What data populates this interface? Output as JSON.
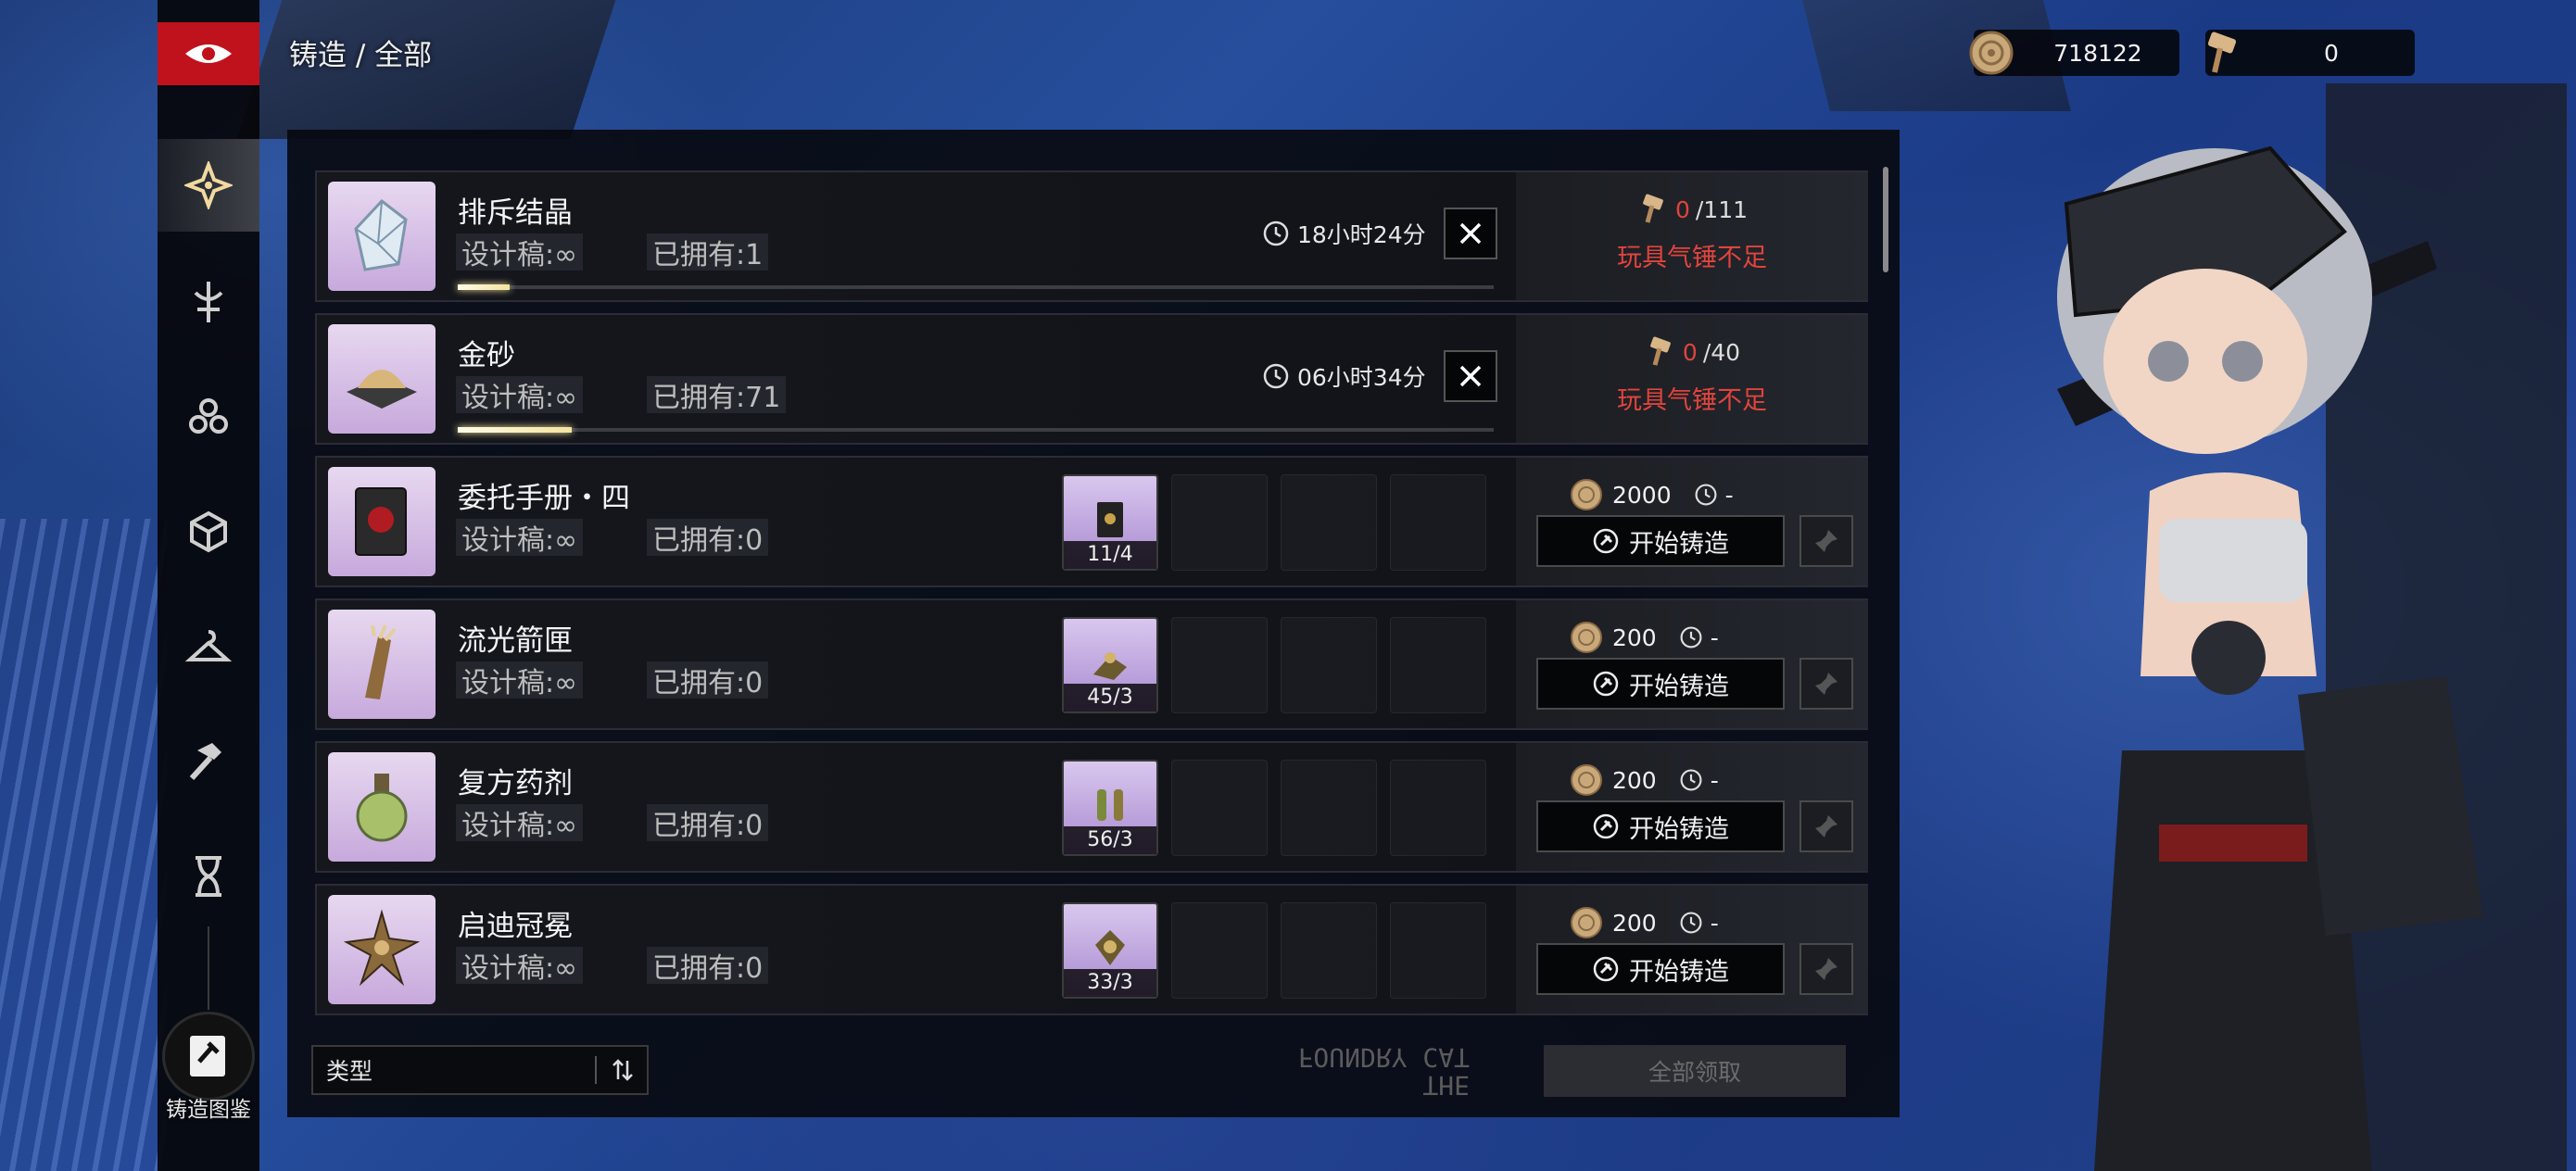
{
  "breadcrumb": "铸造 / 全部",
  "currency": {
    "coins": "718122",
    "hammers": "0"
  },
  "sidebar": {
    "items": [
      "all",
      "weapon",
      "relic",
      "box",
      "hanger",
      "hammer",
      "hourglass"
    ],
    "active_index": 0,
    "codex_label": "铸造图鉴"
  },
  "forging": [
    {
      "name": "排斥结晶",
      "design": "设计稿:∞",
      "owned": "已拥有:1",
      "timer": "18小时24分",
      "progress": 0.05,
      "hammer_have": "0",
      "hammer_need": "/111",
      "warning": "玩具气锤不足"
    },
    {
      "name": "金砂",
      "design": "设计稿:∞",
      "owned": "已拥有:71",
      "timer": "06小时34分",
      "progress": 0.11,
      "hammer_have": "0",
      "hammer_need": "/40",
      "warning": "玩具气锤不足"
    }
  ],
  "recipes": [
    {
      "name": "委托手册・四",
      "design": "设计稿:∞",
      "owned": "已拥有:0",
      "material_count": "11/4",
      "cost": "2000",
      "time": "-",
      "start_label": "开始铸造"
    },
    {
      "name": "流光箭匣",
      "design": "设计稿:∞",
      "owned": "已拥有:0",
      "material_count": "45/3",
      "cost": "200",
      "time": "-",
      "start_label": "开始铸造"
    },
    {
      "name": "复方药剂",
      "design": "设计稿:∞",
      "owned": "已拥有:0",
      "material_count": "56/3",
      "cost": "200",
      "time": "-",
      "start_label": "开始铸造"
    },
    {
      "name": "启迪冠冕",
      "design": "设计稿:∞",
      "owned": "已拥有:0",
      "material_count": "33/3",
      "cost": "200",
      "time": "-",
      "start_label": "开始铸造"
    }
  ],
  "bottom": {
    "filter_label": "类型",
    "claim_all_label": "全部领取",
    "deco_text": "THE\nFOUNDRY CAT"
  },
  "colors": {
    "warning": "#e0443c",
    "accent_red": "#c0121c",
    "progress": "#f3e4a0"
  }
}
